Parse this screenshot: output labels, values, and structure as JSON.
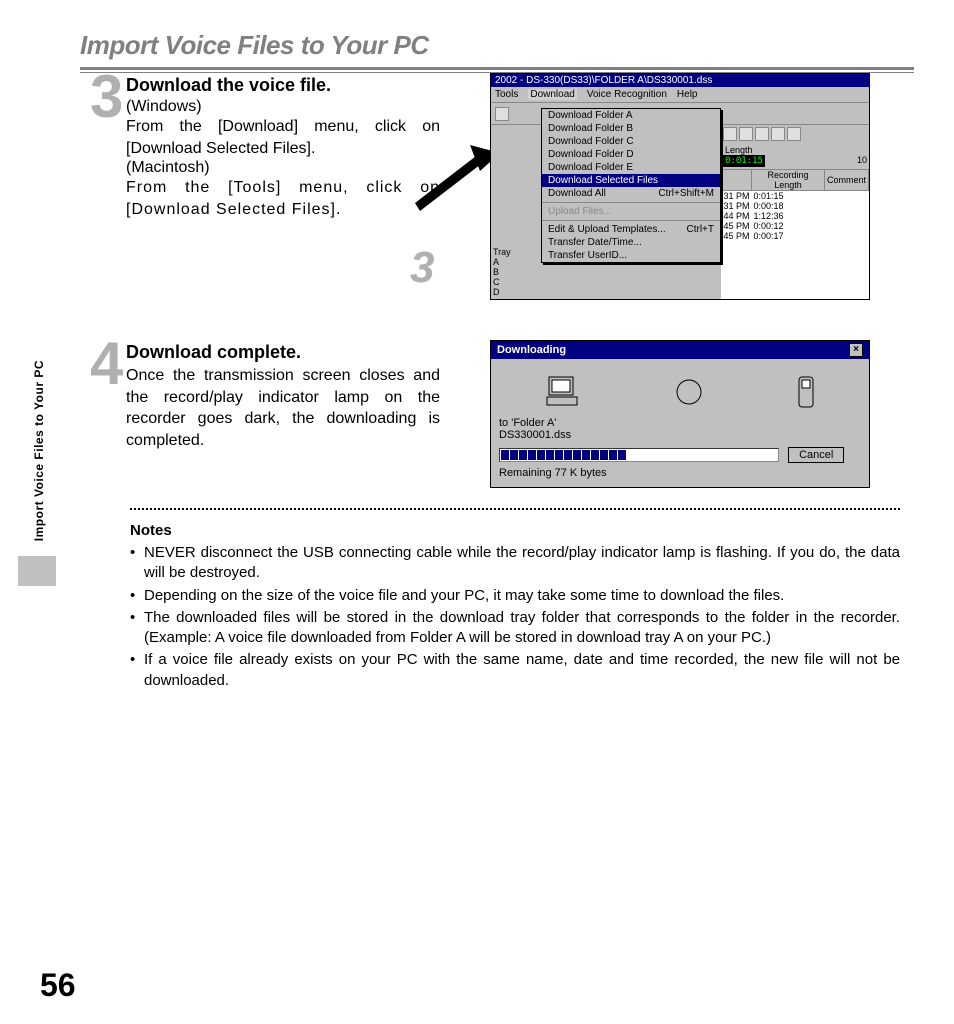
{
  "header": {
    "title": "Import Voice Files to Your PC"
  },
  "sidebar": {
    "label": "Import Voice Files to Your PC"
  },
  "step3": {
    "num": "3",
    "title": "Download the voice file.",
    "win_label": "(Windows)",
    "win_text": "From the [Download] menu, click on [Download Selected Files].",
    "mac_label": "(Macintosh)",
    "mac_text": "From the [Tools] menu, click on [Download Selected Files].",
    "marker": "3"
  },
  "step4": {
    "num": "4",
    "title": "Download complete.",
    "text": "Once the transmission screen closes and the record/play indicator lamp on the recorder goes dark, the downloading is completed."
  },
  "screenshot1": {
    "title": "2002 - DS-330(DS33)\\FOLDER A\\DS330001.dss",
    "menubar": [
      "Tools",
      "Download",
      "Voice Recognition",
      "Help"
    ],
    "dropdown": {
      "items": [
        {
          "label": "Download Folder A",
          "shortcut": ""
        },
        {
          "label": "Download Folder B",
          "shortcut": ""
        },
        {
          "label": "Download Folder C",
          "shortcut": ""
        },
        {
          "label": "Download Folder D",
          "shortcut": ""
        },
        {
          "label": "Download Folder E",
          "shortcut": ""
        }
      ],
      "selected": {
        "label": "Download Selected Files",
        "shortcut": ""
      },
      "all": {
        "label": "Download All",
        "shortcut": "Ctrl+Shift+M"
      },
      "upload": {
        "label": "Upload Files...",
        "shortcut": ""
      },
      "templates": {
        "label": "Edit & Upload Templates...",
        "shortcut": "Ctrl+T"
      },
      "datetime": {
        "label": "Transfer Date/Time...",
        "shortcut": ""
      },
      "userid": {
        "label": "Transfer UserID...",
        "shortcut": ""
      }
    },
    "tray": {
      "title": "Tray",
      "items": [
        "A",
        "B",
        "C",
        "D"
      ]
    },
    "length_label": "Length",
    "length_value": "0:01:15",
    "extra_label": "10",
    "columns": [
      "Recording Length",
      "Comment"
    ],
    "rows": [
      {
        "time": "31 PM",
        "len": "0:01:15"
      },
      {
        "time": "31 PM",
        "len": "0:00:18"
      },
      {
        "time": "44 PM",
        "len": "1:12:36"
      },
      {
        "time": "45 PM",
        "len": "0:00:12"
      },
      {
        "time": "45 PM",
        "len": "0:00:17"
      }
    ]
  },
  "screenshot2": {
    "title": "Downloading",
    "dest": "to 'Folder A'",
    "file": "DS330001.dss",
    "cancel": "Cancel",
    "remaining": "Remaining 77 K bytes"
  },
  "notes": {
    "title": "Notes",
    "items": [
      "NEVER disconnect the USB connecting cable while the record/play indicator lamp is flashing. If you do, the data will be destroyed.",
      "Depending on the size of the voice file and your PC, it may take some time to download the files.",
      "The downloaded files will be stored in the download tray folder that corresponds to the folder in the recorder. (Example: A voice file downloaded from Folder A will be stored in download tray A on your PC.)",
      "If a voice file already exists on your PC with the same name, date and time recorded, the new file will not be downloaded."
    ]
  },
  "pagenum": "56"
}
